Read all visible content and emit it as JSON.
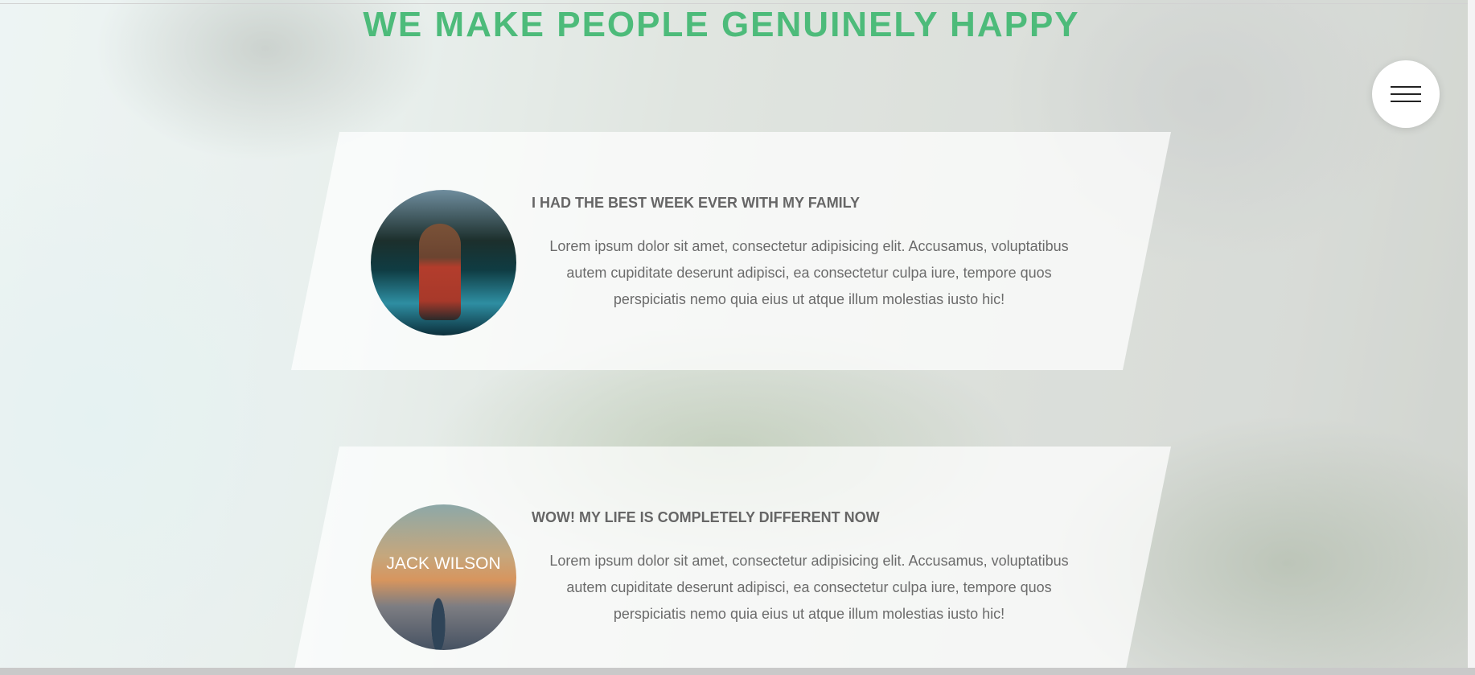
{
  "headline": "WE MAKE PEOPLE GENUINELY HAPPY",
  "menu": {
    "icon": "hamburger-menu-icon"
  },
  "testimonials": [
    {
      "title": "I HAD THE BEST WEEK EVER WITH MY FAMILY",
      "text": "Lorem ipsum dolor sit amet, consectetur adipisicing elit. Accusamus, voluptatibus autem cupiditate deserunt adipisci, ea consectetur culpa iure, tempore quos perspiciatis nemo quia eius ut atque illum molestias iusto hic!",
      "avatar_caption": ""
    },
    {
      "title": "WOW! MY LIFE IS COMPLETELY DIFFERENT NOW",
      "text": "Lorem ipsum dolor sit amet, consectetur adipisicing elit. Accusamus, voluptatibus autem cupiditate deserunt adipisci, ea consectetur culpa iure, tempore quos perspiciatis nemo quia eius ut atque illum molestias iusto hic!",
      "avatar_caption": "JACK WILSON"
    }
  ],
  "colors": {
    "accent": "#4dbb7a",
    "title_text": "#666666",
    "body_text": "#6b6b6b"
  }
}
